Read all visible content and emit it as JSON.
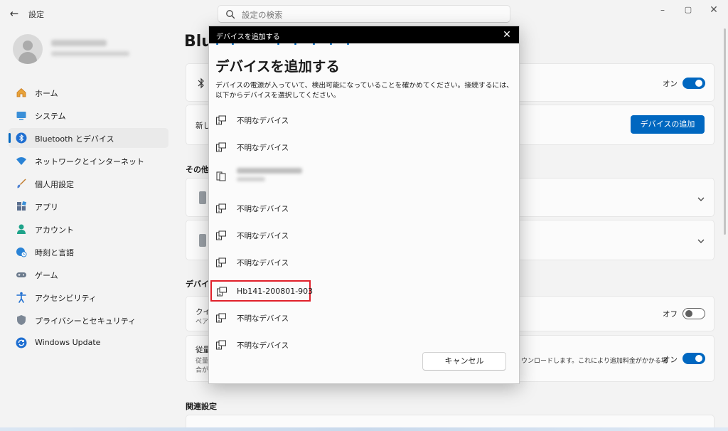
{
  "window": {
    "app_title": "設定",
    "back_glyph": "←",
    "minimize_glyph": "–",
    "maximize_glyph": "▢",
    "close_glyph": "✕"
  },
  "search": {
    "placeholder": "設定の検索"
  },
  "sidebar": {
    "items": [
      {
        "label": "ホーム",
        "icon": "home-icon",
        "active": false
      },
      {
        "label": "システム",
        "icon": "system-icon",
        "active": false
      },
      {
        "label": "Bluetooth とデバイス",
        "icon": "bluetooth-icon",
        "active": true
      },
      {
        "label": "ネットワークとインターネット",
        "icon": "wifi-icon",
        "active": false
      },
      {
        "label": "個人用設定",
        "icon": "brush-icon",
        "active": false
      },
      {
        "label": "アプリ",
        "icon": "apps-icon",
        "active": false
      },
      {
        "label": "アカウント",
        "icon": "account-icon",
        "active": false
      },
      {
        "label": "時刻と言語",
        "icon": "globe-clock-icon",
        "active": false
      },
      {
        "label": "ゲーム",
        "icon": "gamepad-icon",
        "active": false
      },
      {
        "label": "アクセシビリティ",
        "icon": "accessibility-icon",
        "active": false
      },
      {
        "label": "プライバシーとセキュリティ",
        "icon": "shield-icon",
        "active": false
      },
      {
        "label": "Windows Update",
        "icon": "windows-update-icon",
        "active": false
      }
    ]
  },
  "main": {
    "heading": "Blu",
    "bluetooth_toggle_label": "オン",
    "new_device_label": "新し",
    "add_device_button": "デバイスの追加",
    "other_section": "その他の",
    "devices_section": "デバイス",
    "quick_pair_title": "クイ",
    "quick_pair_sub": "ペア",
    "quick_pair_toggle_label": "オフ",
    "metered_title": "従量",
    "metered_sub1": "従量",
    "metered_sub2": "合が",
    "metered_right_text": "ウンロードします。これにより追加料金がかかる場",
    "metered_toggle_label": "オン",
    "related_section": "関連設定"
  },
  "dialog": {
    "titlebar": "デバイスを追加する",
    "close_glyph": "✕",
    "heading": "デバイスを追加する",
    "description": "デバイスの電源が入っていて、検出可能になっていることを確かめてください。接続するには、以下からデバイスを選択してください。",
    "devices": [
      {
        "name": "不明なデバイス"
      },
      {
        "name": "不明なデバイス"
      },
      {
        "name": ""
      },
      {
        "name": "不明なデバイス"
      },
      {
        "name": "不明なデバイス"
      },
      {
        "name": "不明なデバイス"
      },
      {
        "name": "Hb141-200801-903"
      },
      {
        "name": "不明なデバイス"
      },
      {
        "name": "不明なデバイス"
      }
    ],
    "cancel_button": "キャンセル"
  },
  "colors": {
    "accent": "#0067c0",
    "highlight_box": "#e0202a",
    "dialog_titlebar": "#000000"
  }
}
